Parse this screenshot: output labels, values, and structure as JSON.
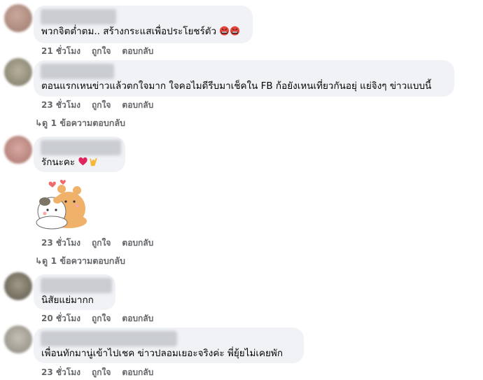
{
  "comments": [
    {
      "text": "พวกจิตต่ำตม.. สร้างกระแสเพื่อประโยชร์ตัว",
      "emoji": [
        "angry-face-icon",
        "angry-face-icon"
      ],
      "time": "21 ชั่วโมง",
      "like": "ถูกใจ",
      "reply": "ตอบกลับ"
    },
    {
      "text": "ตอนแรกเหนข่าวแล้วตกใจมาก ใจคอไมดีรีบมาเช็คใน FB ก้อยังเหนเที่ยวกันอยุ่ แย่จิงๆ ข่าวแบบนี้",
      "time": "23 ชั่วโมง",
      "like": "ถูกใจ",
      "reply": "ตอบกลับ",
      "view_replies": "ดู 1 ข้อความตอบกลับ"
    },
    {
      "text": "รักนะคะ",
      "emoji": [
        "red-heart-icon",
        "love-you-hand-icon"
      ],
      "sticker": "hugging-cat-dog-sticker",
      "time": "23 ชั่วโมง",
      "like": "ถูกใจ",
      "reply": "ตอบกลับ",
      "view_replies": "ดู 1 ข้อความตอบกลับ"
    },
    {
      "text": "นิสัยแย่มากก",
      "time": "20 ชั่วโมง",
      "like": "ถูกใจ",
      "reply": "ตอบกลับ"
    },
    {
      "text": "เพื่อนทักมานู่เข้าไปเชค ข่าวปลอมเยอะจริงค่ะ พี่ยุ้ยไม่เคยพัก",
      "time": "23 ชั่วโมง",
      "like": "ถูกใจ",
      "reply": "ตอบกลับ"
    }
  ],
  "colors": {
    "bubble": "#f0f2f5",
    "meta": "#65676b",
    "text": "#050505"
  }
}
